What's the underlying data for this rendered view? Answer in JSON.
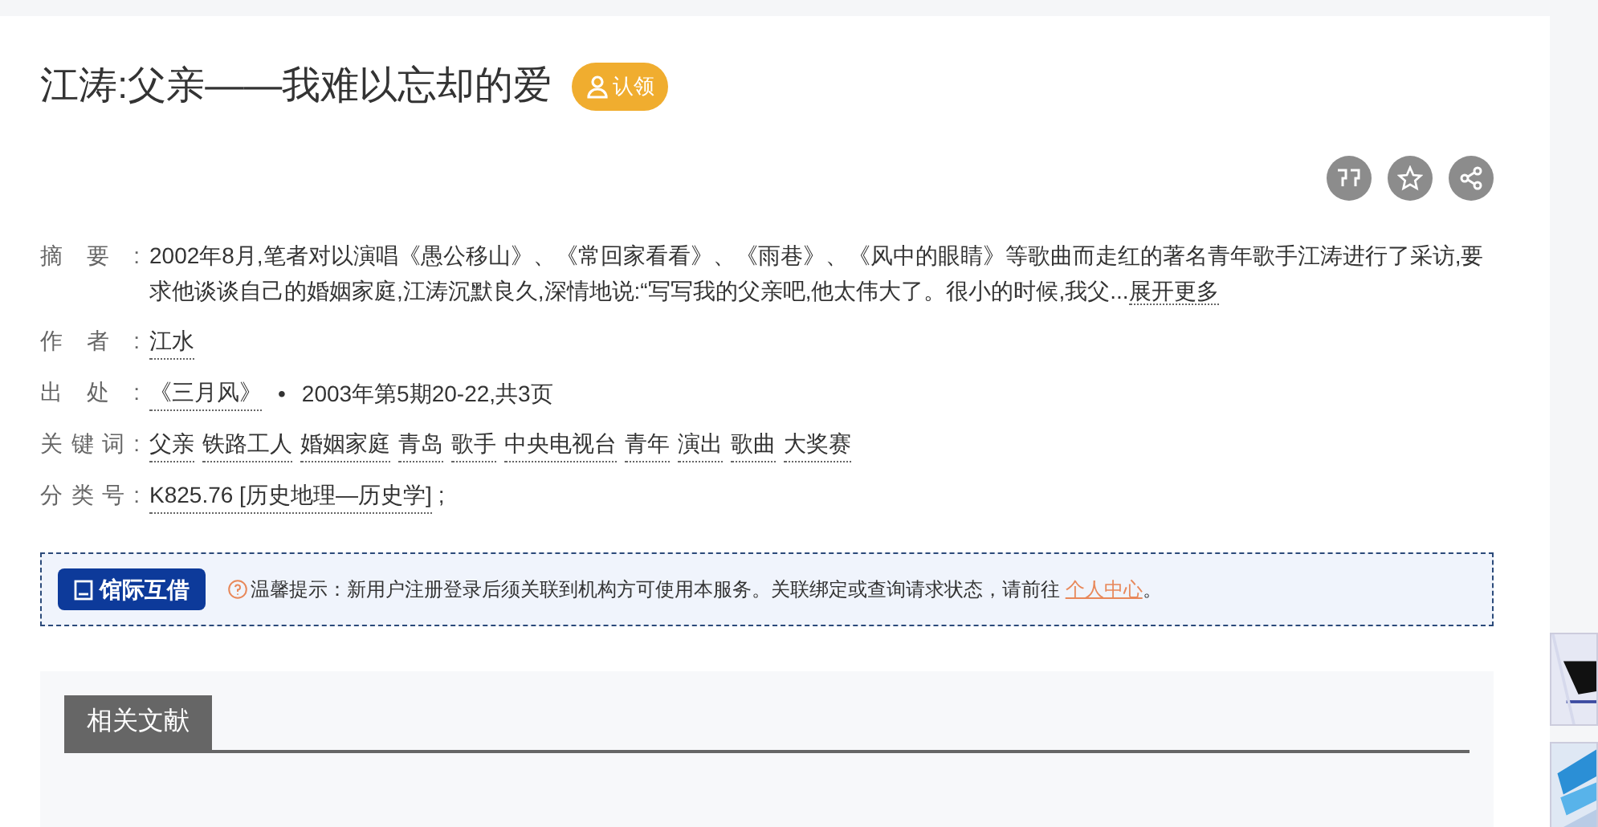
{
  "title": "江涛:父亲——我难以忘却的爱",
  "claim_button": "认领",
  "fields": [
    {
      "kind": "abstract",
      "label": "摘要:",
      "text": "2002年8月,笔者对以演唱《愚公移山》、《常回家看看》、《雨巷》、《风中的眼睛》等歌曲而走红的著名青年歌手江涛进行了采访,要求他谈谈自己的婚姻家庭,江涛沉默良久,深情地说:“写写我的父亲吧,他太伟大了。很小的时候,我父...",
      "more": "展开更多"
    },
    {
      "kind": "links",
      "label": "作者:",
      "links": [
        "江水"
      ]
    },
    {
      "kind": "source",
      "label": "出处:",
      "journal": "《三月风》",
      "separator": "•",
      "detail": "2003年第5期20-22,共3页"
    },
    {
      "kind": "links",
      "label": "关键词:",
      "links": [
        "父亲",
        "铁路工人",
        "婚姻家庭",
        "青岛",
        "歌手",
        "中央电视台",
        "青年",
        "演出",
        "歌曲",
        "大奖赛"
      ]
    },
    {
      "kind": "class",
      "label": "分类号:",
      "code": "K825.76 [历史地理—历史学]",
      "suffix": ";"
    }
  ],
  "loan": {
    "button": "馆际互借",
    "tip": "温馨提示：新用户注册登录后须关联到机构方可使用本服务。关联绑定或查询请求状态，请前往",
    "link": "个人中心",
    "end": "。"
  },
  "related_tab": "相关文献"
}
